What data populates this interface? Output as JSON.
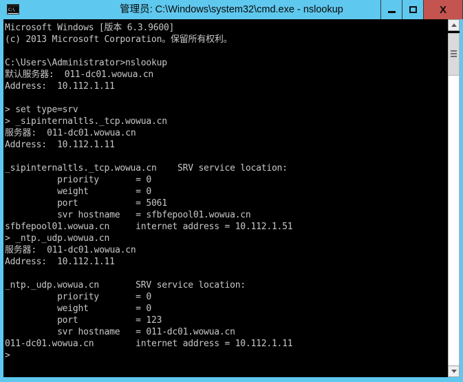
{
  "window": {
    "title": "管理员: C:\\Windows\\system32\\cmd.exe - nslookup",
    "icon_text": "C:\\",
    "icon_name": "cmd-icon",
    "titlebar_color": "#5fc8ee",
    "close_color": "#c35450",
    "console_bg": "#000000",
    "console_fg": "#c8c8c8"
  },
  "controls": {
    "minimize_label": "–",
    "maximize_label": "□",
    "close_label": "X"
  },
  "scrollbar": {
    "up_label": "∧",
    "down_label": "∨"
  },
  "console": {
    "lines": [
      "Microsoft Windows [版本 6.3.9600]",
      "(c) 2013 Microsoft Corporation。保留所有权利。",
      "",
      "C:\\Users\\Administrator>nslookup",
      "默认服务器:  011-dc01.wowua.cn",
      "Address:  10.112.1.11",
      "",
      "> set type=srv",
      "> _sipinternaltls._tcp.wowua.cn",
      "服务器:  011-dc01.wowua.cn",
      "Address:  10.112.1.11",
      "",
      "_sipinternaltls._tcp.wowua.cn    SRV service location:",
      "          priority       = 0",
      "          weight         = 0",
      "          port           = 5061",
      "          svr hostname   = sfbfepool01.wowua.cn",
      "sfbfepool01.wowua.cn     internet address = 10.112.1.51",
      "> _ntp._udp.wowua.cn",
      "服务器:  011-dc01.wowua.cn",
      "Address:  10.112.1.11",
      "",
      "_ntp._udp.wowua.cn       SRV service location:",
      "          priority       = 0",
      "          weight         = 0",
      "          port           = 123",
      "          svr hostname   = 011-dc01.wowua.cn",
      "011-dc01.wowua.cn        internet address = 10.112.1.11",
      ">"
    ]
  }
}
